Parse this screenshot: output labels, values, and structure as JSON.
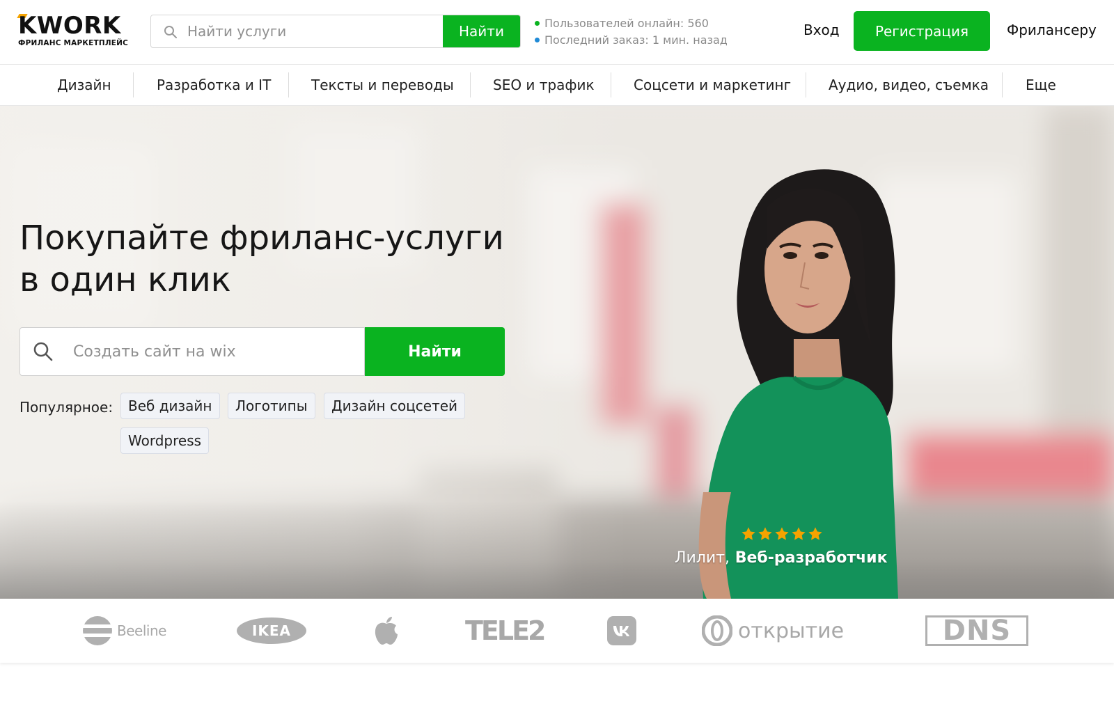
{
  "brand": {
    "name": "KWORK",
    "tagline": "ФРИЛАНС МАРКЕТПЛЕЙС",
    "accent": "#0ab320",
    "logo_mark": "#f5a300"
  },
  "header": {
    "search_placeholder": "Найти услуги",
    "search_button": "Найти",
    "stats": [
      "Пользователей онлайн: 560",
      "Последний заказ: 1 мин. назад"
    ],
    "login": "Вход",
    "register": "Регистрация",
    "freelancer": "Фрилансеру"
  },
  "categories": [
    "Дизайн",
    "Разработка и IT",
    "Тексты и переводы",
    "SEO и трафик",
    "Соцсети и маркетинг",
    "Аудио, видео, съемка",
    "Еще"
  ],
  "hero": {
    "title_lines": [
      "Покупайте фриланс-услуги",
      "в один клик"
    ],
    "search_placeholder": "Создать сайт на wix",
    "search_button": "Найти",
    "popular_label": "Популярное:",
    "popular_tags": [
      "Веб дизайн",
      "Логотипы",
      "Дизайн соцсетей",
      "Wordpress"
    ],
    "person_name": "Лилит,",
    "person_role": "Веб-разработчик",
    "rating_stars": 5,
    "star_color": "#f5a300"
  },
  "clients": {
    "logos": [
      "Beeline",
      "IKEA",
      "apple-logo",
      "TELE2",
      "vk-logo",
      "открытие",
      "DNS"
    ],
    "logo_color": "#a8a8a8"
  }
}
